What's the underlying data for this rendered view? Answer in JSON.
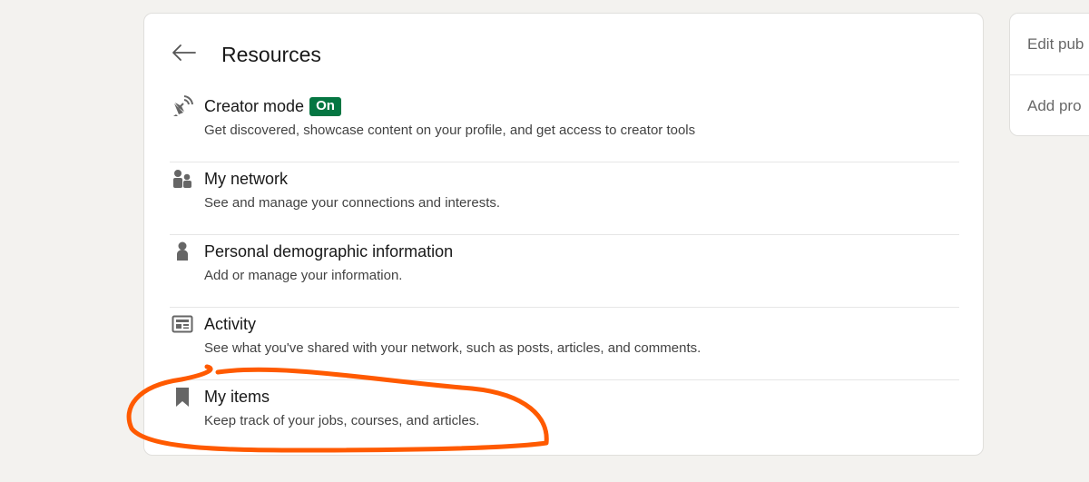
{
  "resources": {
    "title": "Resources",
    "items": [
      {
        "label": "Creator mode",
        "badge": "On",
        "description": "Get discovered, showcase content on your profile, and get access to creator tools",
        "icon": "satellite-dish-icon"
      },
      {
        "label": "My network",
        "description": "See and manage your connections and interests.",
        "icon": "people-icon"
      },
      {
        "label": "Personal demographic information",
        "description": "Add or manage your information.",
        "icon": "person-icon"
      },
      {
        "label": "Activity",
        "description": "See what you've shared with your network, such as posts, articles, and comments.",
        "icon": "newspaper-icon"
      },
      {
        "label": "My items",
        "description": "Keep track of your jobs, courses, and articles.",
        "icon": "bookmark-icon"
      }
    ]
  },
  "side_panel": {
    "link_1": "Edit pub",
    "link_2": "Add pro"
  },
  "colors": {
    "badge": "#057642",
    "annotation": "#ff5a00",
    "background": "#f3f2ef"
  }
}
